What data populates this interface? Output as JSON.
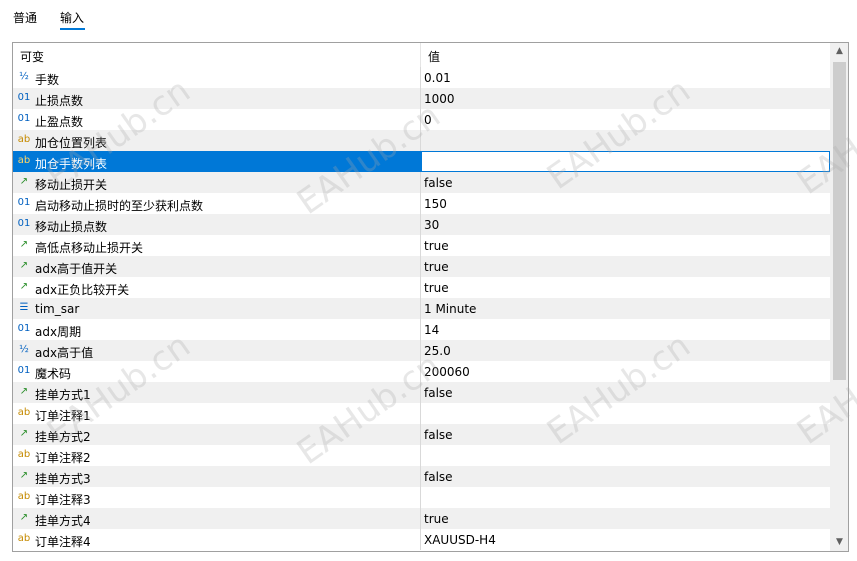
{
  "tabs": [
    {
      "label": "普通"
    },
    {
      "label": "输入"
    }
  ],
  "columns": {
    "name": "可变",
    "value": "值"
  },
  "rows": [
    {
      "icon": "½",
      "icon_type": "double",
      "name": "手数",
      "value": "0.01"
    },
    {
      "icon": "01",
      "icon_type": "int",
      "name": "止损点数",
      "value": "1000"
    },
    {
      "icon": "01",
      "icon_type": "int",
      "name": "止盈点数",
      "value": "0"
    },
    {
      "icon": "ab",
      "icon_type": "string",
      "name": "加仓位置列表",
      "value": ""
    },
    {
      "icon": "ab",
      "icon_type": "string",
      "name": "加仓手数列表",
      "value": "",
      "selected": true
    },
    {
      "icon": "↗",
      "icon_type": "bool",
      "name": "移动止损开关",
      "value": "false"
    },
    {
      "icon": "01",
      "icon_type": "int",
      "name": "启动移动止损时的至少获利点数",
      "value": "150"
    },
    {
      "icon": "01",
      "icon_type": "int",
      "name": "移动止损点数",
      "value": "30"
    },
    {
      "icon": "↗",
      "icon_type": "bool",
      "name": "高低点移动止损开关",
      "value": "true"
    },
    {
      "icon": "↗",
      "icon_type": "bool",
      "name": "adx高于值开关",
      "value": "true"
    },
    {
      "icon": "↗",
      "icon_type": "bool",
      "name": "adx正负比较开关",
      "value": "true"
    },
    {
      "icon": "☰",
      "icon_type": "enum",
      "name": "tim_sar",
      "value": "1 Minute"
    },
    {
      "icon": "01",
      "icon_type": "int",
      "name": "adx周期",
      "value": "14"
    },
    {
      "icon": "½",
      "icon_type": "double",
      "name": "adx高于值",
      "value": "25.0"
    },
    {
      "icon": "01",
      "icon_type": "int",
      "name": "魔术码",
      "value": "200060"
    },
    {
      "icon": "↗",
      "icon_type": "bool",
      "name": "挂单方式1",
      "value": "false"
    },
    {
      "icon": "ab",
      "icon_type": "string",
      "name": "订单注释1",
      "value": ""
    },
    {
      "icon": "↗",
      "icon_type": "bool",
      "name": "挂单方式2",
      "value": "false"
    },
    {
      "icon": "ab",
      "icon_type": "string",
      "name": "订单注释2",
      "value": ""
    },
    {
      "icon": "↗",
      "icon_type": "bool",
      "name": "挂单方式3",
      "value": "false"
    },
    {
      "icon": "ab",
      "icon_type": "string",
      "name": "订单注释3",
      "value": ""
    },
    {
      "icon": "↗",
      "icon_type": "bool",
      "name": "挂单方式4",
      "value": "true"
    },
    {
      "icon": "ab",
      "icon_type": "string",
      "name": "订单注释4",
      "value": "XAUUSD-H4"
    }
  ],
  "watermark": "EAHub.cn",
  "colors": {
    "selected": "#0078d7",
    "alt_row": "#f0f0f0"
  }
}
